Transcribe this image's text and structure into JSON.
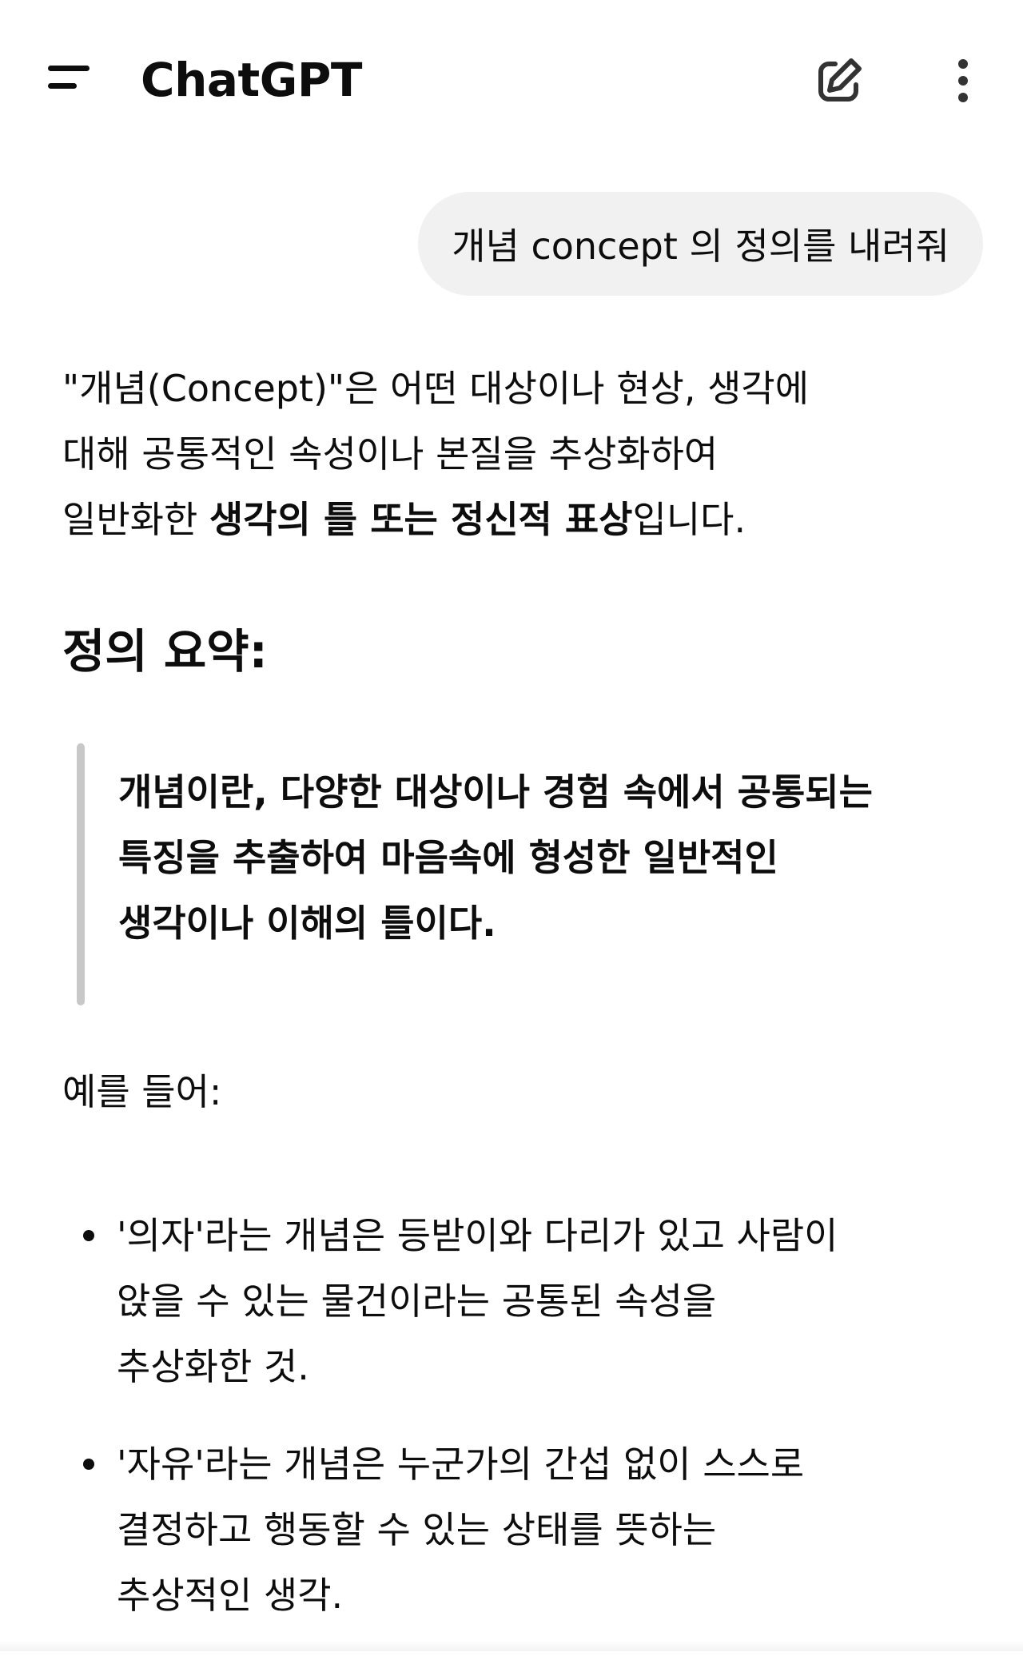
{
  "header": {
    "title": "ChatGPT",
    "menu_icon": "hamburger-menu-icon",
    "new_chat_icon": "edit-square-icon",
    "more_icon": "vertical-ellipsis-icon"
  },
  "conversation": {
    "user_message": "개념 concept 의 정의를 내려줘",
    "assistant": {
      "intro_lines": [
        "\"개념(Concept)\"은 어떤 대상이나 현상, 생각에",
        "대해 공통적인 속성이나 본질을 추상화하여"
      ],
      "intro_line3_prefix": "일반화한 ",
      "intro_line3_bold": "생각의 틀 또는 정신적 표상",
      "intro_line3_suffix": "입니다.",
      "heading": "정의 요약:",
      "quote_lines": [
        "개념이란, 다양한 대상이나 경험 속에서 공통되는",
        "특징을 추출하여 마음속에 형성한 일반적인",
        "생각이나 이해의 틀이다."
      ],
      "example_label": "예를 들어:",
      "bullets": [
        {
          "lines": [
            "'의자'라는 개념은 등받이와 다리가 있고 사람이",
            "앉을 수 있는 물건이라는 공통된 속성을",
            "추상화한 것."
          ]
        },
        {
          "lines": [
            "'자유'라는 개념은 누군가의 간섭 없이 스스로",
            "결정하고 행동할 수 있는 상태를 뜻하는",
            "추상적인 생각."
          ]
        }
      ]
    }
  }
}
